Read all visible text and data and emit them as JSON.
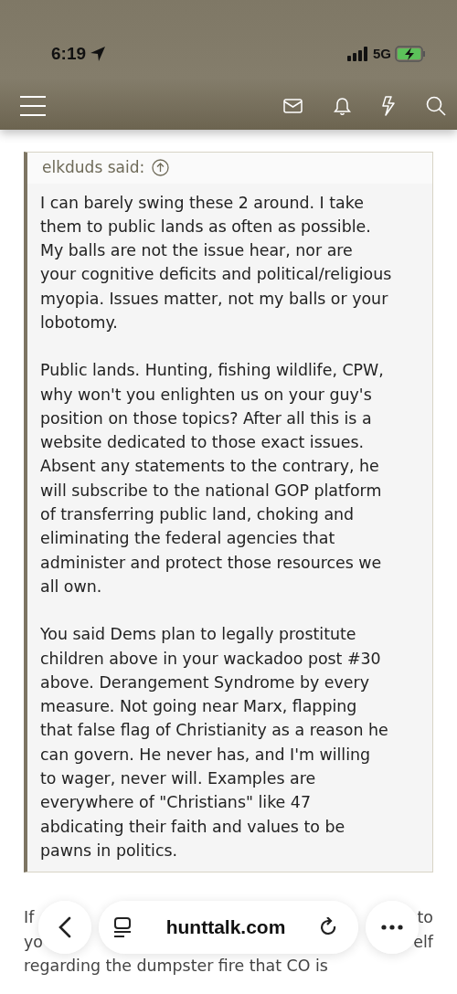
{
  "status_bar": {
    "time": "6:19",
    "network": "5G"
  },
  "quote": {
    "author": "elkduds said:",
    "paragraphs": [
      {
        "lines": [
          "I can barely swing these 2 around. I take",
          "them to public lands as often as possible.",
          "My balls are not the issue hear, nor are",
          "your cognitive deficits and political/religious",
          "myopia. Issues matter, not my balls or your",
          "lobotomy."
        ]
      },
      {
        "lines": [
          "Public lands. Hunting, fishing wildlife, CPW,",
          "why won't you enlighten us on your guy's",
          "position on those topics? After all this is a",
          "website dedicated to those exact issues.",
          "Absent any statements to the contrary, he",
          "will subscribe to the national GOP platform",
          "of transferring public land, choking and",
          "eliminating the federal agencies that",
          "administer and protect those resources we",
          "all own."
        ]
      },
      {
        "lines": [
          "You said Dems plan to legally prostitute",
          "children above in your wackadoo post #30",
          "above. Derangement Syndrome by every",
          "measure. Not going near Marx, flapping",
          "that false flag of Christianity as a reason he",
          "can govern. He never has, and I'm willing",
          "to wager, never will. Examples are",
          "everywhere of \"Christians\" like 47",
          "abdicating their faith and values to be",
          "pawns in politics."
        ]
      }
    ]
  },
  "reply_fragments": [
    [
      "If",
      "to"
    ],
    [
      "yo",
      "elf"
    ]
  ],
  "reply_lines": [
    "regarding the dumpster fire that CO is"
  ],
  "browser_bar": {
    "url": "hunttalk.com"
  }
}
